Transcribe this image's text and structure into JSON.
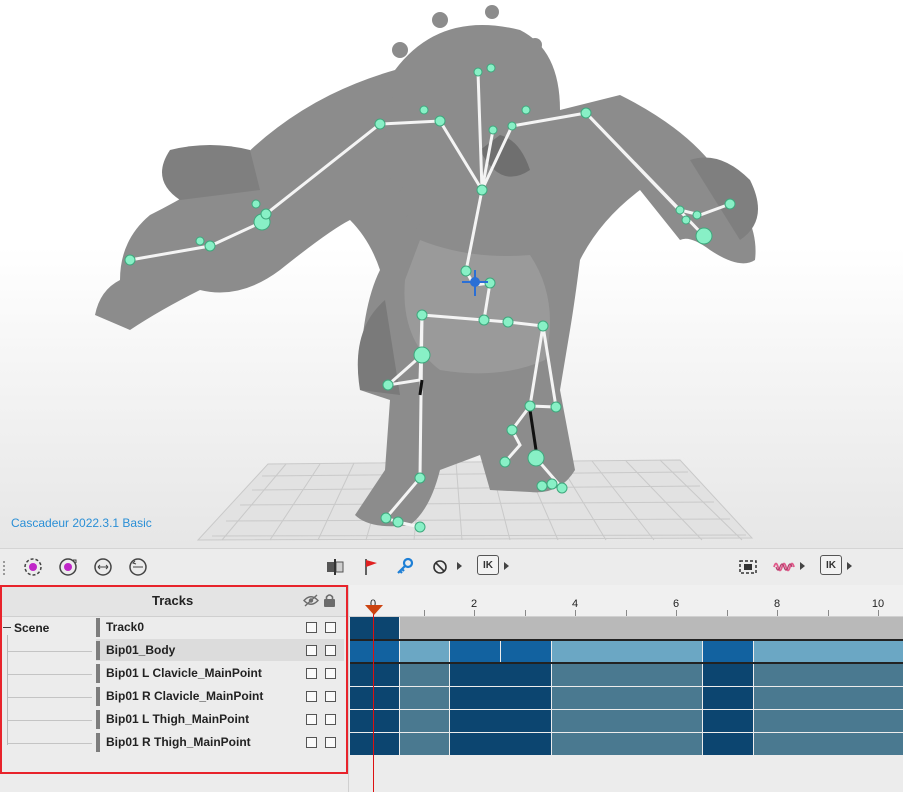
{
  "viewport": {
    "version_label": "Cascadeur 2022.3.1 Basic"
  },
  "toolbar": {
    "left_icons": [
      "select-all-icon",
      "select-joints-icon",
      "move-icon",
      "rotate-icon"
    ],
    "center_icons": [
      "mirror-icon",
      "flag-icon",
      "key-icon",
      "no-icon"
    ],
    "ik_label": "IK",
    "right_icons": [
      "frame-icon",
      "wave-icon"
    ],
    "ik_label_2": "IK"
  },
  "tracks": {
    "title": "Tracks",
    "scene_label": "Scene",
    "rows": [
      {
        "name": "Track0"
      },
      {
        "name": "Bip01_Body"
      },
      {
        "name": "Bip01 L Clavicle_MainPoint"
      },
      {
        "name": "Bip01 R Clavicle_MainPoint"
      },
      {
        "name": "Bip01 L Thigh_MainPoint"
      },
      {
        "name": "Bip01 R Thigh_MainPoint"
      }
    ]
  },
  "timeline": {
    "ruler_labels": [
      "0",
      "2",
      "4",
      "6",
      "8",
      "10"
    ],
    "current_frame": 0,
    "colors": {
      "dark": "#0c4570",
      "mid": "#4a7990",
      "body_dark": "#1262a0",
      "body_light": "#6ba7c4",
      "track_gray": "#b9b9b9"
    }
  }
}
